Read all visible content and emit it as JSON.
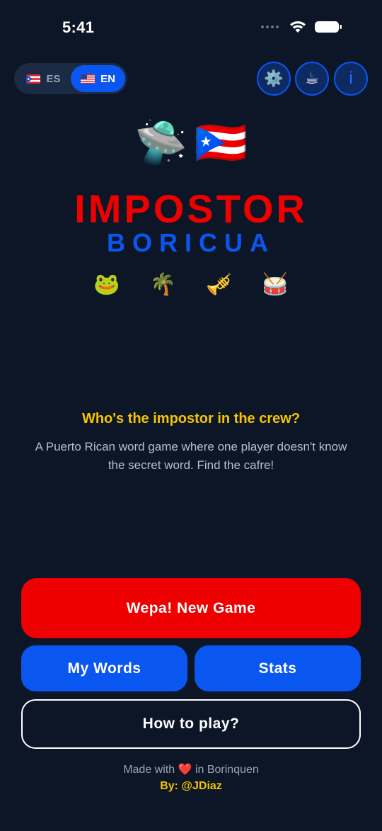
{
  "status_bar": {
    "time": "5:41"
  },
  "language": {
    "options": [
      {
        "code": "ES",
        "flag": "puerto-rico-flag",
        "active": false
      },
      {
        "code": "EN",
        "flag": "us-flag",
        "active": true
      }
    ]
  },
  "header_icons": {
    "settings": "⚙️",
    "coffee": "☕",
    "info": "i"
  },
  "hero": {
    "emoji_top": [
      "🛸",
      "🇵🇷"
    ],
    "title": "IMPOSTOR",
    "subtitle": "BORICUA",
    "emoji_row": [
      "🐸",
      "🌴",
      "🎺",
      "🥁"
    ]
  },
  "tagline": "Who's the impostor in the crew?",
  "description": "A Puerto Rican word game where one player doesn't know the secret word. Find the cafre!",
  "buttons": {
    "new_game": "Wepa! New Game",
    "my_words": "My Words",
    "stats": "Stats",
    "how_to_play": "How to play?"
  },
  "footer": {
    "made_with_prefix": "Made with",
    "heart": "❤️",
    "made_with_suffix": "in Borinquen",
    "by": "By: @JDiaz"
  },
  "colors": {
    "background": "#0c1627",
    "red": "#ee0000",
    "blue": "#0a56f0",
    "yellow": "#f5c400"
  }
}
